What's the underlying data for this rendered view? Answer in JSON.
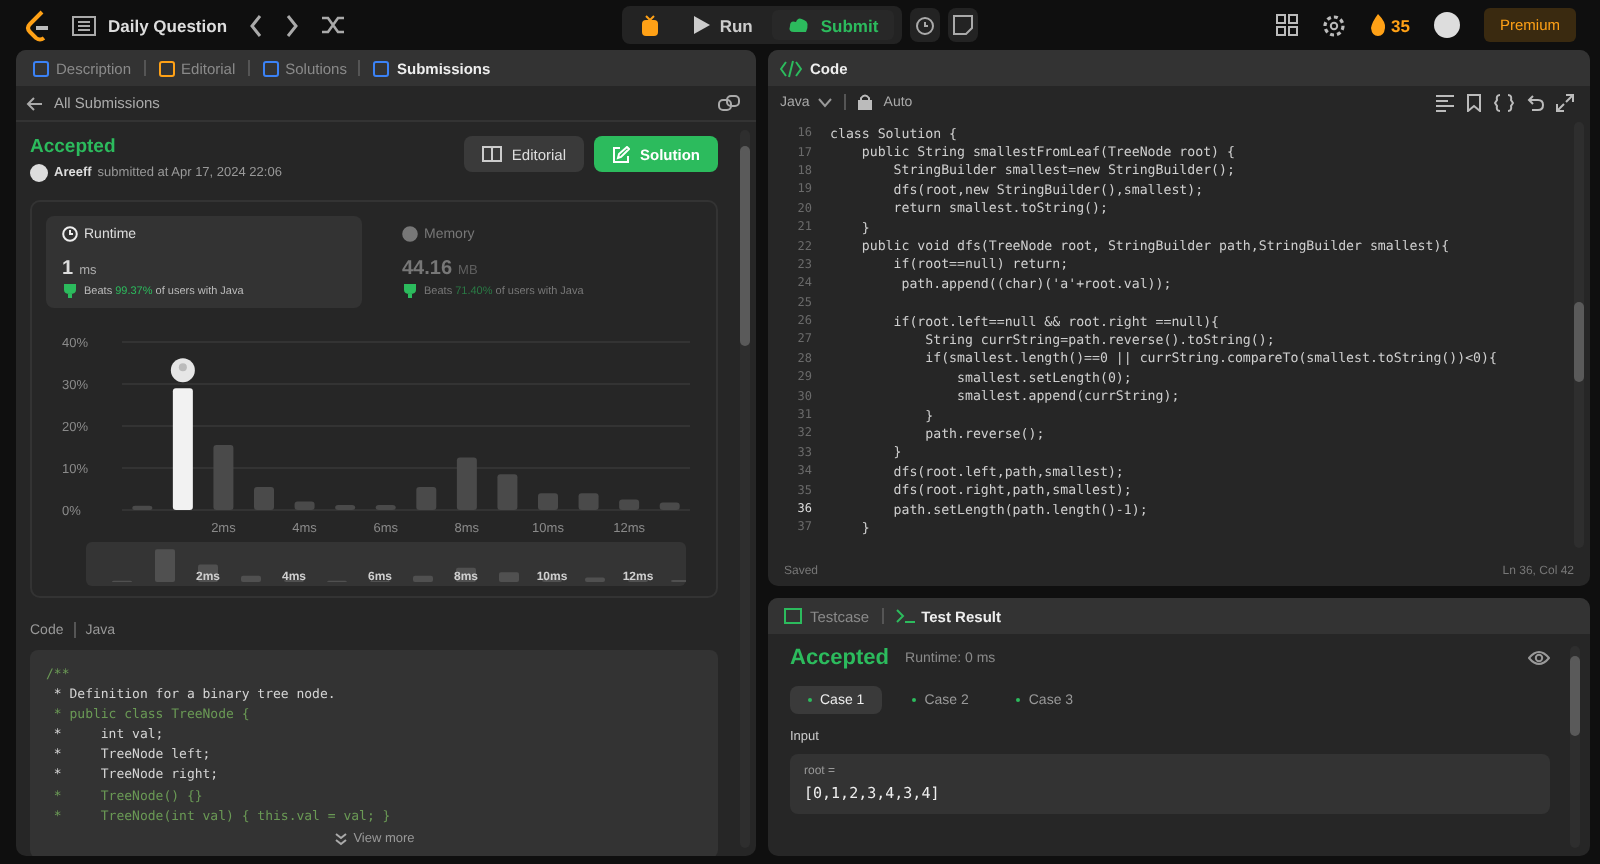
{
  "topbar": {
    "title": "Daily Question",
    "run": "Run",
    "submit": "Submit",
    "streak": "35",
    "premium": "Premium"
  },
  "left_tabs": [
    {
      "label": "Description",
      "selected": false
    },
    {
      "label": "Editorial",
      "selected": false
    },
    {
      "label": "Solutions",
      "selected": false
    },
    {
      "label": "Submissions",
      "selected": true
    }
  ],
  "back_link": "All Submissions",
  "submission": {
    "status": "Accepted",
    "user": "Areeff",
    "submitted": "submitted at Apr 17, 2024 22:06",
    "editorial": "Editorial",
    "solution": "Solution"
  },
  "metrics": [
    {
      "label": "Runtime",
      "value": "1",
      "unit": "ms",
      "beats": "Beats",
      "percent": "99.37%",
      "suffix": "of users with Java",
      "selected": true
    },
    {
      "label": "Memory",
      "value": "44.16",
      "unit": "MB",
      "beats": "Beats",
      "percent": "71.40%",
      "suffix": "of users with Java",
      "selected": false
    }
  ],
  "chart_data": {
    "type": "bar",
    "x": [
      0,
      1,
      2,
      3,
      4,
      5,
      6,
      7,
      8,
      9,
      10,
      11,
      12,
      13
    ],
    "series": [
      {
        "color": "#4a4a4a",
        "values": [
          1,
          null,
          15.5,
          5.5,
          2,
          1.2,
          1.2,
          5.5,
          12.5,
          8.5,
          4,
          4,
          2.5,
          1.8
        ]
      },
      {
        "color": "#f2f2f2",
        "values": [
          null,
          29,
          null,
          null,
          null,
          null,
          null,
          null,
          null,
          null,
          null,
          null,
          null,
          null
        ]
      }
    ],
    "stacked": true,
    "xlim": [
      -0.5,
      13.5
    ],
    "ylim": [
      0,
      40
    ],
    "grid": true,
    "yticks": [
      {
        "value": 0,
        "label": "0%"
      },
      {
        "value": 10,
        "label": "10%"
      },
      {
        "value": 20,
        "label": "20%"
      },
      {
        "value": 30,
        "label": "30%"
      },
      {
        "value": 40,
        "label": "40%"
      }
    ],
    "xticks": [
      {
        "value": 2,
        "label": "2ms"
      },
      {
        "value": 4,
        "label": "4ms"
      },
      {
        "value": 6,
        "label": "6ms"
      },
      {
        "value": 8,
        "label": "8ms"
      },
      {
        "value": 10,
        "label": "10ms"
      },
      {
        "value": 12,
        "label": "12ms"
      }
    ]
  },
  "overview_labels": [
    "2ms",
    "4ms",
    "6ms",
    "8ms",
    "10ms",
    "12ms"
  ],
  "code_view": {
    "label": "Code",
    "language": "Java",
    "more": "View more",
    "lines": [
      {
        "text": "/**",
        "kind": "comment"
      },
      {
        "text": " * Definition for a binary tree node.",
        "kind": "text"
      },
      {
        "text": " * public class TreeNode {",
        "kind": "comment"
      },
      {
        "text": " *     int val;",
        "kind": "text"
      },
      {
        "text": " *     TreeNode left;",
        "kind": "text"
      },
      {
        "text": " *     TreeNode right;",
        "kind": "text"
      },
      {
        "text": " *     TreeNode() {}",
        "kind": "comment"
      },
      {
        "text": " *     TreeNode(int val) { this.val = val; }",
        "kind": "comment"
      }
    ]
  },
  "editor": {
    "title": "Code",
    "language": "Java",
    "mode": "Auto",
    "status": "Saved",
    "cursor": "Ln 36, Col 42",
    "lines": [
      {
        "num": "16",
        "text": "class Solution {",
        "current": false
      },
      {
        "num": "17",
        "text": "    public String smallestFromLeaf(TreeNode root) {",
        "current": false
      },
      {
        "num": "18",
        "text": "        StringBuilder smallest=new StringBuilder();",
        "current": false
      },
      {
        "num": "19",
        "text": "        dfs(root,new StringBuilder(),smallest);",
        "current": false
      },
      {
        "num": "20",
        "text": "        return smallest.toString();",
        "current": false
      },
      {
        "num": "21",
        "text": "    }",
        "current": false
      },
      {
        "num": "22",
        "text": "    public void dfs(TreeNode root, StringBuilder path,StringBuilder smallest){",
        "current": false
      },
      {
        "num": "23",
        "text": "        if(root==null) return;",
        "current": false
      },
      {
        "num": "24",
        "text": "         path.append((char)('a'+root.val));",
        "current": false
      },
      {
        "num": "25",
        "current": false
      },
      {
        "num": "26",
        "text": "        if(root.left==null && root.right ==null){",
        "current": false
      },
      {
        "num": "27",
        "text": "            String currString=path.reverse().toString();",
        "current": false
      },
      {
        "num": "28",
        "text": "            if(smallest.length()==0 || currString.compareTo(smallest.toString())<0){",
        "current": false
      },
      {
        "num": "29",
        "text": "                smallest.setLength(0);",
        "current": false
      },
      {
        "num": "30",
        "text": "                smallest.append(currString);",
        "current": false
      },
      {
        "num": "31",
        "text": "            }",
        "current": false
      },
      {
        "num": "32",
        "text": "            path.reverse();",
        "current": false
      },
      {
        "num": "33",
        "text": "        }",
        "current": false
      },
      {
        "num": "34",
        "text": "        dfs(root.left,path,smallest);",
        "current": false
      },
      {
        "num": "35",
        "text": "        dfs(root.right,path,smallest);",
        "current": false
      },
      {
        "num": "36",
        "text": "        path.setLength(path.length()-1);",
        "current": true
      },
      {
        "num": "37",
        "text": "    }",
        "current": false
      }
    ]
  },
  "result": {
    "tabs": [
      {
        "label": "Testcase",
        "selected": false
      },
      {
        "label": "Test Result",
        "selected": true
      }
    ],
    "status": "Accepted",
    "runtime": "Runtime: 0 ms",
    "cases": [
      {
        "label": "Case 1",
        "selected": true
      },
      {
        "label": "Case 2",
        "selected": false
      },
      {
        "label": "Case 3",
        "selected": false
      }
    ],
    "input_label": "Input",
    "param": "root =",
    "value": "[0,1,2,3,4,3,4]"
  }
}
